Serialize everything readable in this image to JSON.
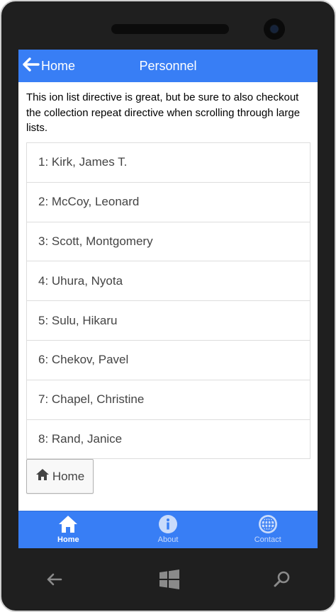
{
  "header": {
    "back_label": "Home",
    "title": "Personnel"
  },
  "intro_text": "This ion list directive is great, but be sure to also checkout the collection repeat directive when scrolling through large lists.",
  "list": {
    "items": [
      "1: Kirk, James T.",
      "2: McCoy, Leonard",
      "3: Scott, Montgomery",
      "4: Uhura, Nyota",
      "5: Sulu, Hikaru",
      "6: Chekov, Pavel",
      "7: Chapel, Christine",
      "8: Rand, Janice"
    ]
  },
  "home_button": {
    "label": "Home",
    "icon": "home-icon"
  },
  "tabs": [
    {
      "label": "Home",
      "icon": "home-icon",
      "active": true
    },
    {
      "label": "About",
      "icon": "info-icon",
      "active": false
    },
    {
      "label": "Contact",
      "icon": "globe-icon",
      "active": false
    }
  ],
  "device_nav": {
    "back_icon": "back-arrow-icon",
    "start_icon": "windows-logo-icon",
    "search_icon": "search-icon"
  },
  "colors": {
    "accent": "#387ef5",
    "frame": "#1f1f1f"
  }
}
